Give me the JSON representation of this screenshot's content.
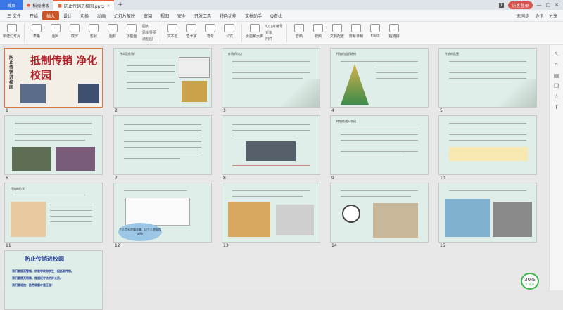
{
  "tabs": {
    "home": "首页",
    "template": "稻壳模板",
    "doc": "防止传销进校园.pptx",
    "badge": "1",
    "login": "访客登录"
  },
  "menu": {
    "file": "三 文件",
    "items": [
      "开始",
      "插入",
      "设计",
      "切换",
      "动画",
      "幻灯片放映",
      "审阅",
      "视图",
      "安全",
      "开发工具",
      "特色功能",
      "文档助手",
      "Q查找"
    ],
    "right": [
      "未同步",
      "协作",
      "分享"
    ]
  },
  "ribbon": [
    "新建幻灯片",
    "表格",
    "图片",
    "截屏",
    "形状",
    "图标",
    "功能图",
    "图表",
    "思维导图",
    "流程图",
    "文本框",
    "艺术字",
    "符号",
    "公式",
    "页眉和页脚",
    "幻灯片编号",
    "对象",
    "附件",
    "文档部件",
    "音频",
    "视频",
    "文档配置",
    "屏幕录制",
    "Flash",
    "超链接"
  ],
  "slides": {
    "numbers": [
      "1",
      "2",
      "3",
      "4",
      "5",
      "6",
      "7",
      "8",
      "9",
      "10",
      "11",
      "12",
      "13",
      "14",
      "15",
      "16"
    ],
    "s1_title": "抵制传销 净化校园",
    "s1_left": "防止传销进校园",
    "s2_title": "什么是传销？",
    "s3_title": "传销的特点",
    "s4_title": "传销的组织结构",
    "s5_title": "传销的危害",
    "s9_title": "传销的进入手段",
    "s11_title": "传销的形式",
    "s12_caption": "个人信息泄露诈骗、以个人隐私相威胁",
    "s16_title": "防止传销进校园",
    "s16_lines": [
      "我们要提高警惕，依靠学校和学生一起抵制传销。",
      "我们要擦亮眼睛，做遵纪守法的好公民。",
      "我们要相信：勤劳致富才是正道！"
    ]
  },
  "perf": {
    "pct": "30%",
    "rate": "0.5K/s"
  }
}
